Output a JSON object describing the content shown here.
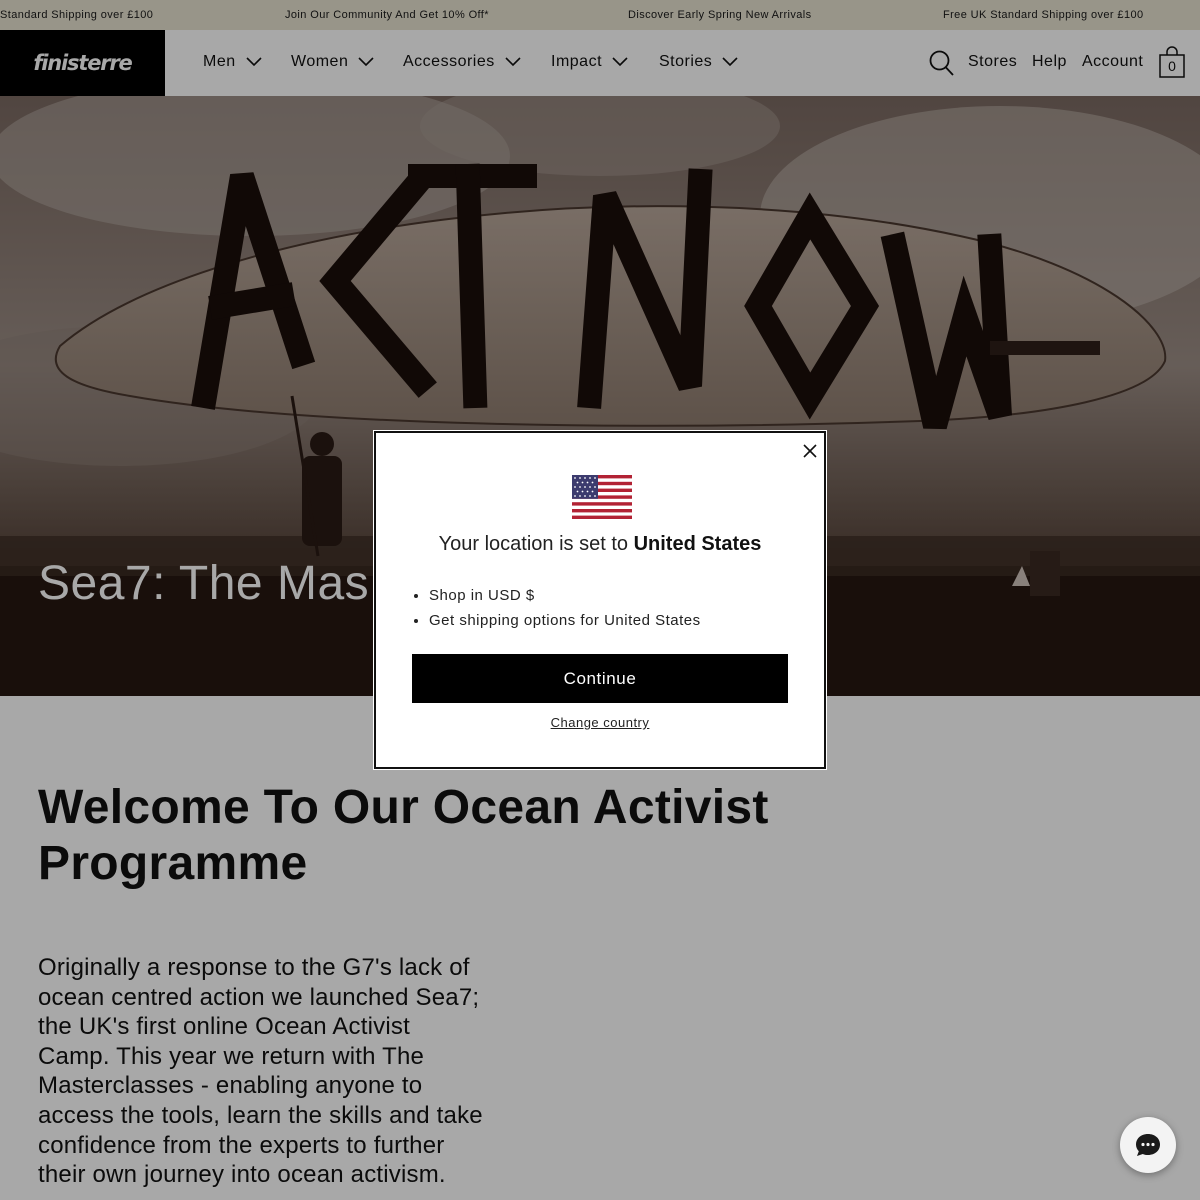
{
  "announcement": {
    "items": [
      "Standard Shipping over £100",
      "Join Our Community And Get 10% Off*",
      "Discover Early Spring New Arrivals",
      "Free UK Standard Shipping over £100"
    ]
  },
  "header": {
    "logo": "finisterre",
    "nav": [
      {
        "label": "Men",
        "icon": "chevron-down-icon"
      },
      {
        "label": "Women",
        "icon": "chevron-down-icon"
      },
      {
        "label": "Accessories",
        "icon": "chevron-down-icon"
      },
      {
        "label": "Impact",
        "icon": "chevron-down-icon"
      },
      {
        "label": "Stories",
        "icon": "chevron-down-icon"
      }
    ],
    "search_icon": "search-icon",
    "utility": {
      "stores": "Stores",
      "help": "Help",
      "account": "Account"
    },
    "cart": {
      "icon": "bag-icon",
      "count": "0"
    }
  },
  "hero": {
    "surfboard_text": "ACT NOW",
    "title": "Sea7: The Mas",
    "tone": "#3a2a22"
  },
  "content": {
    "title": "Welcome To Our Ocean Activist Programme",
    "body": "Originally a response to the G7's lack of ocean centred action we launched Sea7; the UK's first online Ocean Activist Camp. This year we return with The Masterclasses - enabling anyone to access the tools, learn the skills and take confidence from the experts to further their own journey into ocean activism."
  },
  "modal": {
    "flag_icon": "us-flag-icon",
    "location_prefix": "Your location is set to ",
    "location_country": "United States",
    "bullets": [
      "Shop in USD $",
      "Get shipping options for United States"
    ],
    "continue_label": "Continue",
    "change_label": "Change country",
    "close_icon": "close-icon"
  },
  "chat": {
    "icon": "chat-bubble-icon"
  },
  "colors": {
    "announcement_bg": "#e7e3d1",
    "logo_bg": "#000000",
    "button_bg": "#000000",
    "overlay": "rgba(0,0,0,0.34)"
  }
}
